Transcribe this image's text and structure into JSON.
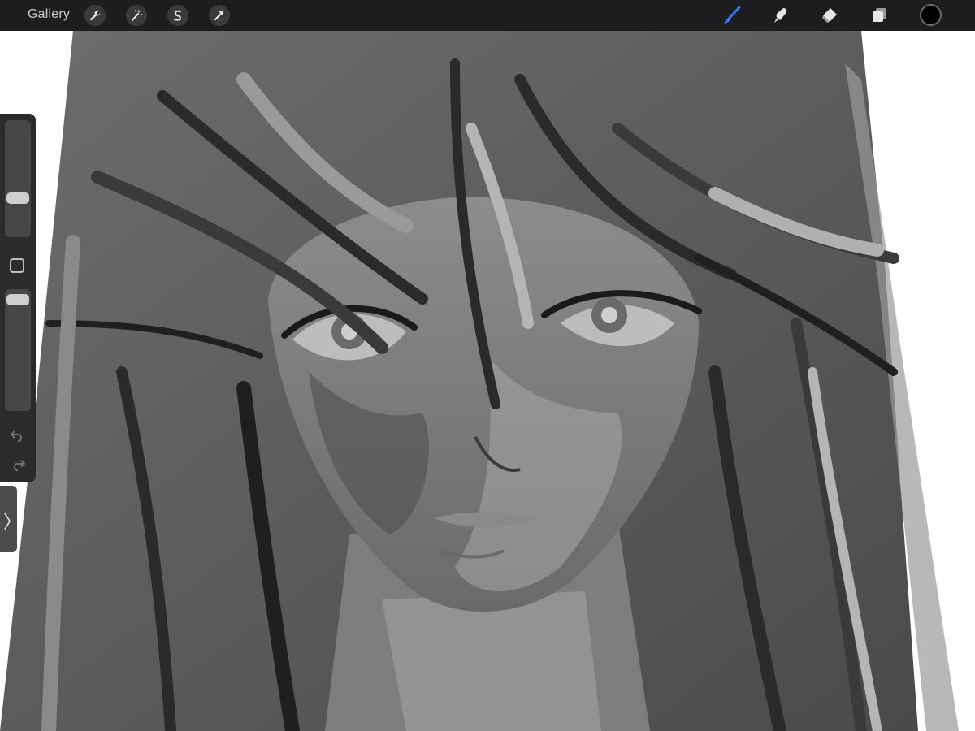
{
  "toolbar": {
    "gallery_label": "Gallery",
    "left_tools": [
      "wrench-icon",
      "magic-wand-icon",
      "selection-icon",
      "transform-arrow-icon"
    ],
    "right_tools": [
      "brush-icon",
      "smudge-icon",
      "eraser-icon",
      "layers-icon",
      "color-swatch"
    ],
    "active_tool": "brush",
    "accent_color": "#2f7bf5",
    "current_color": "#000000"
  },
  "sidebar": {
    "brush_size_level": 0.38,
    "opacity_level": 0.92,
    "icons": [
      "modify-square-icon",
      "undo-icon",
      "redo-icon"
    ]
  },
  "expand_tab": {
    "label": "〉"
  }
}
